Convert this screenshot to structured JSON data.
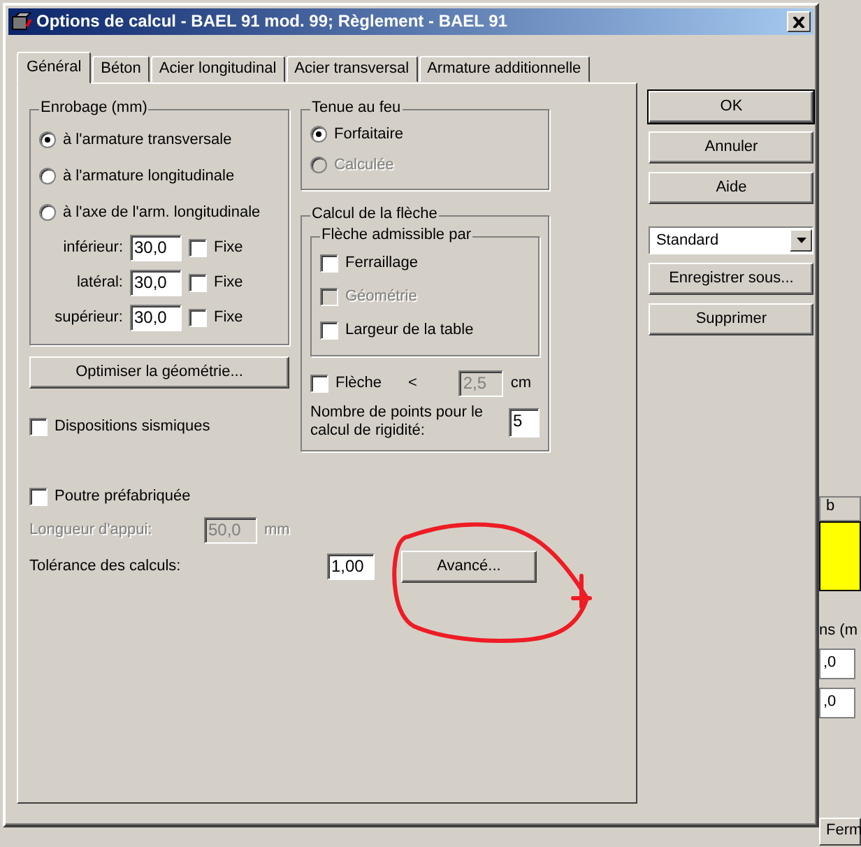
{
  "window": {
    "title": "Options de calcul - BAEL 91 mod. 99;  Règlement - BAEL 91"
  },
  "tabs": [
    {
      "label": "Général",
      "selected": true
    },
    {
      "label": "Béton",
      "selected": false
    },
    {
      "label": "Acier longitudinal",
      "selected": false
    },
    {
      "label": "Acier transversal",
      "selected": false
    },
    {
      "label": "Armature additionnelle",
      "selected": false
    }
  ],
  "enrobage": {
    "title": "Enrobage (mm)",
    "options": [
      {
        "label": "à l'armature transversale",
        "selected": true
      },
      {
        "label": "à l'armature longitudinale",
        "selected": false
      },
      {
        "label": "à l'axe de l'arm. longitudinale",
        "selected": false
      }
    ],
    "fields": [
      {
        "label": "inférieur:",
        "value": "30,0",
        "fixe_label": "Fixe",
        "fixe_checked": false
      },
      {
        "label": "latéral:",
        "value": "30,0",
        "fixe_label": "Fixe",
        "fixe_checked": false
      },
      {
        "label": "supérieur:",
        "value": "30,0",
        "fixe_label": "Fixe",
        "fixe_checked": false
      }
    ]
  },
  "optimize_button": "Optimiser la géométrie...",
  "seismic": {
    "label": "Dispositions sismiques",
    "checked": false
  },
  "tenue_au_feu": {
    "title": "Tenue au feu",
    "options": [
      {
        "label": "Forfaitaire",
        "selected": true,
        "disabled": false
      },
      {
        "label": "Calculée",
        "selected": false,
        "disabled": true
      }
    ]
  },
  "fleche": {
    "title": "Calcul de la flèche",
    "admissible": {
      "title": "Flèche admissible par",
      "items": [
        {
          "label": "Ferraillage",
          "checked": false,
          "disabled": false
        },
        {
          "label": "Géométrie",
          "checked": false,
          "disabled": true
        },
        {
          "label": "Largeur de la table",
          "checked": false,
          "disabled": false
        }
      ]
    },
    "limit": {
      "label": "Flèche",
      "checked": false,
      "operator": "<",
      "value": "2,5",
      "unit": "cm",
      "disabled": true
    },
    "points": {
      "label": "Nombre de points pour le calcul de rigidité:",
      "value": "5"
    }
  },
  "prefab": {
    "label": "Poutre préfabriquée",
    "checked": false
  },
  "bearing": {
    "label": "Longueur d'appui:",
    "value": "50,0",
    "unit": "mm",
    "disabled": true
  },
  "tolerance": {
    "label": "Tolérance des calculs:",
    "value": "1,00"
  },
  "advanced_button": "Avancé...",
  "side_buttons": [
    {
      "label": "OK",
      "default": true
    },
    {
      "label": "Annuler",
      "default": false
    },
    {
      "label": "Aide",
      "default": false
    }
  ],
  "preset": {
    "value": "Standard"
  },
  "preset_buttons": [
    "Enregistrer sous...",
    "Supprimer"
  ],
  "background": {
    "column_header": "b",
    "label": "ns (m",
    "values": [
      ",0",
      ",0"
    ],
    "button": "Ferm"
  }
}
